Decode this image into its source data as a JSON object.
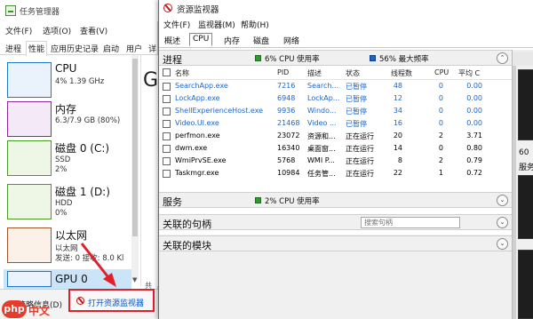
{
  "task_manager": {
    "title": "任务管理器",
    "menu": [
      "文件(F)",
      "选项(O)",
      "查看(V)"
    ],
    "tabs": [
      "进程",
      "性能",
      "应用历史记录",
      "启动",
      "用户",
      "详"
    ],
    "active_tab": "性能",
    "perf_items": [
      {
        "name": "CPU",
        "line2": "4% 1.39 GHz",
        "line3": "",
        "color": "#1e78c8",
        "fill": "#eaf3fb"
      },
      {
        "name": "内存",
        "line2": "6.3/7.9 GB (80%)",
        "line3": "",
        "color": "#8b2a9a",
        "fill": "#f4e9f6"
      },
      {
        "name": "磁盘 0 (C:)",
        "line2": "SSD",
        "line3": "2%",
        "color": "#4b9a2a",
        "fill": "#eef6e6"
      },
      {
        "name": "磁盘 1 (D:)",
        "line2": "HDD",
        "line3": "0%",
        "color": "#4b9a2a",
        "fill": "#eef6e6"
      },
      {
        "name": "以太网",
        "line2": "以太网",
        "line3": "发送: 0 接收: 8.0 Kl",
        "color": "#a0522d",
        "fill": "#fbf1e8"
      },
      {
        "name": "GPU 0",
        "line2": "",
        "line3": "",
        "color": "#1e78c8",
        "fill": "#eaf3fb"
      }
    ],
    "right_glyph": "G",
    "right_small": "共",
    "fewer_details": "简略信息(D)",
    "open_resource_monitor": "打开资源监视器"
  },
  "watermark": {
    "logo": "php",
    "text": "中文网"
  },
  "resource_monitor": {
    "title": "资源监视器",
    "menu": [
      "文件(F)",
      "监视器(M)",
      "帮助(H)"
    ],
    "tabs": [
      "概述",
      "CPU",
      "内存",
      "磁盘",
      "网络"
    ],
    "active_tab": "CPU",
    "processes": {
      "title": "进程",
      "cpu_usage": "6% CPU 使用率",
      "max_freq": "56% 最大频率",
      "columns": [
        "名称",
        "PID",
        "描述",
        "状态",
        "线程数",
        "CPU",
        "平均 C"
      ],
      "rows": [
        {
          "name": "SearchApp.exe",
          "pid": "7216",
          "desc": "Search...",
          "status": "已暂停",
          "threads": "48",
          "cpu": "0",
          "avg": "0.00",
          "suspended": true
        },
        {
          "name": "LockApp.exe",
          "pid": "6948",
          "desc": "LockAp...",
          "status": "已暂停",
          "threads": "12",
          "cpu": "0",
          "avg": "0.00",
          "suspended": true
        },
        {
          "name": "ShellExperienceHost.exe",
          "pid": "9936",
          "desc": "Windo...",
          "status": "已暂停",
          "threads": "34",
          "cpu": "0",
          "avg": "0.00",
          "suspended": true
        },
        {
          "name": "Video.UI.exe",
          "pid": "21468",
          "desc": "Video ...",
          "status": "已暂停",
          "threads": "16",
          "cpu": "0",
          "avg": "0.00",
          "suspended": true
        },
        {
          "name": "perfmon.exe",
          "pid": "23072",
          "desc": "资源和...",
          "status": "正在运行",
          "threads": "20",
          "cpu": "2",
          "avg": "3.71",
          "suspended": false
        },
        {
          "name": "dwm.exe",
          "pid": "16340",
          "desc": "桌面窗...",
          "status": "正在运行",
          "threads": "14",
          "cpu": "0",
          "avg": "0.80",
          "suspended": false
        },
        {
          "name": "WmiPrvSE.exe",
          "pid": "5768",
          "desc": "WMI P...",
          "status": "正在运行",
          "threads": "8",
          "cpu": "2",
          "avg": "0.79",
          "suspended": false
        },
        {
          "name": "Taskmgr.exe",
          "pid": "10984",
          "desc": "任务管...",
          "status": "正在运行",
          "threads": "22",
          "cpu": "1",
          "avg": "0.72",
          "suspended": false
        }
      ]
    },
    "services": {
      "title": "服务",
      "cpu_usage": "2% CPU 使用率"
    },
    "handles": {
      "title": "关联的句柄",
      "search_placeholder": "搜索句柄"
    },
    "modules": {
      "title": "关联的模块"
    },
    "right_panel": {
      "v1": "60",
      "v2": "服务"
    }
  }
}
